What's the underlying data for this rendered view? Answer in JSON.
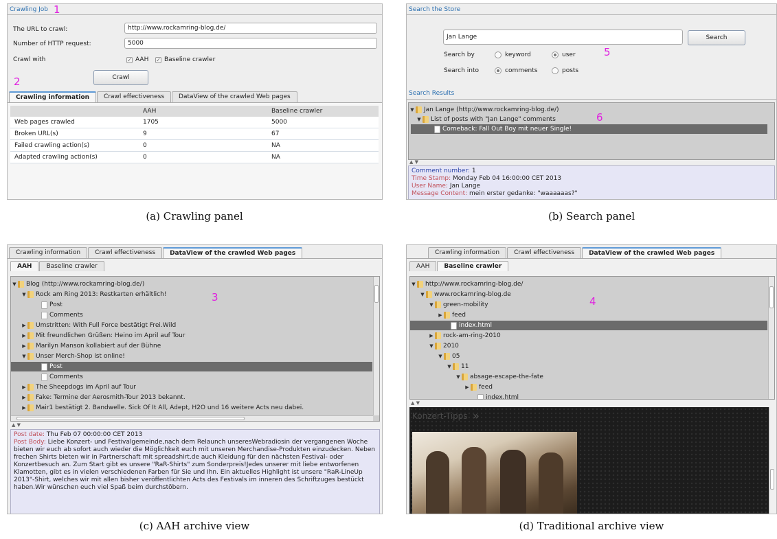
{
  "panel_a": {
    "group_title": "Crawling Job",
    "url_label": "The URL to crawl:",
    "url_value": "http://www.rockamring-blog.de/",
    "requests_label": "Number of HTTP request:",
    "requests_value": "5000",
    "crawl_with_label": "Crawl with",
    "check_aah": "AAH",
    "check_baseline": "Baseline crawler",
    "crawl_button": "Crawl",
    "tabs": [
      "Crawling information",
      "Crawl effectiveness",
      "DataView of the crawled Web pages"
    ],
    "table": {
      "headers": [
        "",
        "AAH",
        "Baseline crawler"
      ],
      "rows": [
        [
          "Web pages crawled",
          "1705",
          "5000"
        ],
        [
          "Broken URL(s)",
          "9",
          "67"
        ],
        [
          "Failed crawling action(s)",
          "0",
          "NA"
        ],
        [
          "Adapted crawling action(s)",
          "0",
          "NA"
        ]
      ]
    }
  },
  "panel_b": {
    "search_group_title": "Search the Store",
    "search_value": "Jan Lange",
    "search_button": "Search",
    "search_by_label": "Search by",
    "opt_keyword": "keyword",
    "opt_user": "user",
    "search_into_label": "Search into",
    "opt_comments": "comments",
    "opt_posts": "posts",
    "results_group_title": "Search Results",
    "tree": [
      "Jan Lange (http://www.rockamring-blog.de/)",
      "List of posts with \"Jan Lange\" comments",
      "Comeback: Fall Out Boy mit neuer Single!"
    ],
    "detail": {
      "k1": "Comment number:",
      "v1": "1",
      "k2": "Time Stamp:",
      "v2": "Monday Feb 04 16:00:00 CET 2013",
      "k3": "User Name:",
      "v3": "Jan Lange",
      "k4": "Message Content:",
      "v4": "mein erster gedanke: \"waaaaaas?\""
    }
  },
  "panel_c": {
    "tabs": [
      "Crawling information",
      "Crawl effectiveness",
      "DataView of the crawled Web pages"
    ],
    "subtabs": [
      "AAH",
      "Baseline crawler"
    ],
    "tree": [
      "Blog (http://www.rockamring-blog.de/)",
      "Rock am Ring 2013: Restkarten erhältlich!",
      "Post",
      "Comments",
      "Umstritten: With Full Force bestätigt Frei.Wild",
      "Mit freundlichen Grüßen: Heino im April auf Tour",
      "Marilyn Manson kollabiert auf der Bühne",
      "Unser Merch-Shop ist online!",
      "Post",
      "Comments",
      "The Sheepdogs im April auf Tour",
      "Fake: Termine der Aerosmith-Tour 2013 bekannt.",
      "Mair1 bestätigt 2. Bandwelle. Sick Of It All, Adept, H2O und 16 weitere Acts neu dabei."
    ],
    "detail_date_key": "Post date:",
    "detail_date_value": "Thu Feb 07 00:00:00 CET 2013",
    "detail_body_key": "Post Body:",
    "detail_body_value": "Liebe Konzert- und Festivalgemeinde,nach dem Relaunch unseresWebradiosin der vergangenen Woche bieten wir euch ab sofort auch wieder die Möglichkeit euch mit unseren Merchandise-Produkten einzudecken. Neben frechen Shirts bieten wir in Partnerschaft mit spreadshirt.de auch Kleidung für den nächsten Festival- oder Konzertbesuch an. Zum Start gibt es unsere \"RaR-Shirts\" zum Sonderpreis!Jedes unserer mit liebe entworfenen Klamotten, gibt es in vielen verschiedenen Farben für Sie und Ihn. Ein aktuelles Highlight ist unsere \"RaR-LineUp 2013\"-Shirt, welches wir mit allen bisher veröffentlichten Acts des Festivals im inneren des Schriftzuges bestückt haben.Wir wünschen euch viel Spaß beim durchstöbern."
  },
  "panel_d": {
    "tabs": [
      "Crawling information",
      "Crawl effectiveness",
      "DataView of the crawled Web pages"
    ],
    "subtabs": [
      "AAH",
      "Baseline crawler"
    ],
    "tree": [
      "http://www.rockamring-blog.de/",
      "www.rockamring-blog.de",
      "green-mobility",
      "feed",
      "index.html",
      "rock-am-ring-2010",
      "2010",
      "05",
      "11",
      "absage-escape-the-fate",
      "feed",
      "index.html"
    ],
    "web_preview_heading": "Konzert-Tipps"
  },
  "annotations": [
    "1",
    "2",
    "3",
    "4",
    "5",
    "6"
  ],
  "captions": [
    "(a) Crawling panel",
    "(b) Search panel",
    "(c) AAH archive view",
    "(d) Traditional archive view"
  ]
}
